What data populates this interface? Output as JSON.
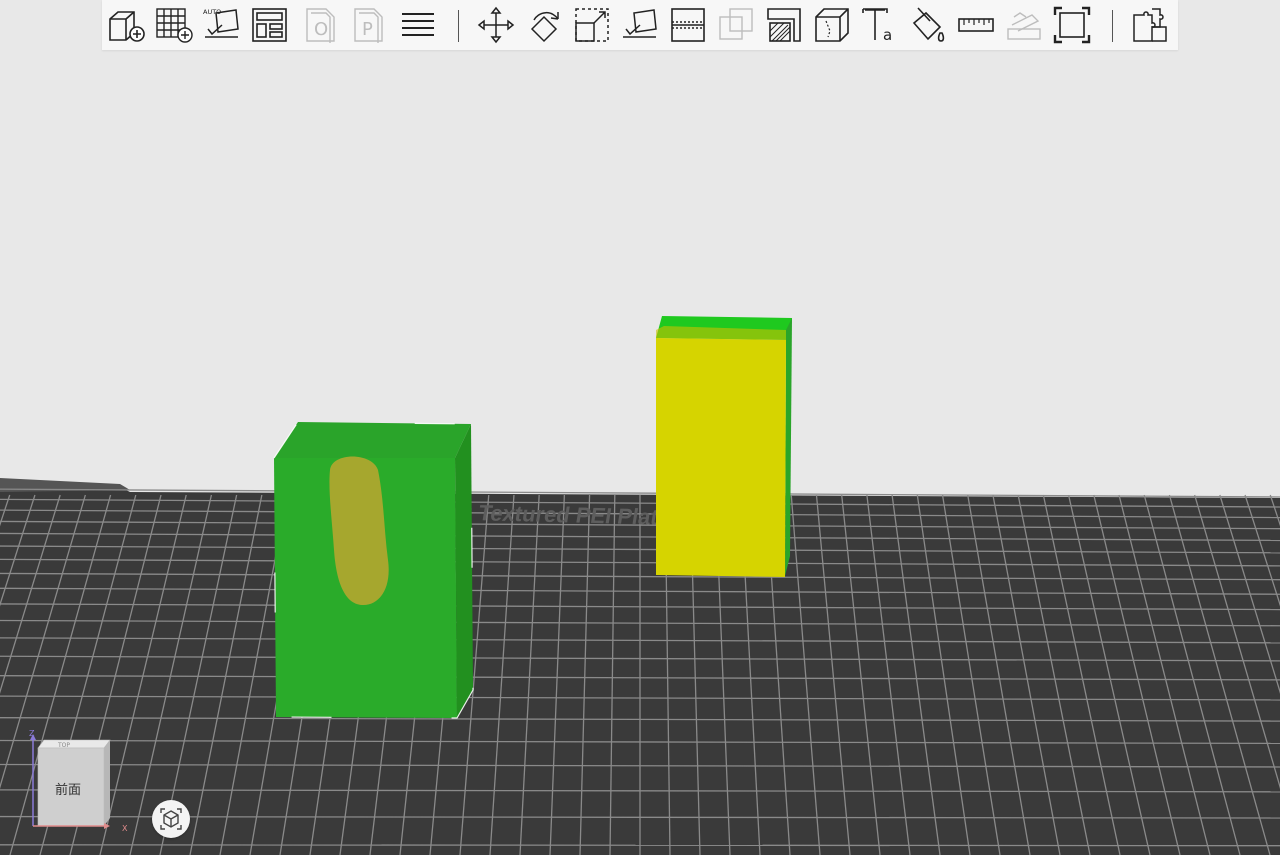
{
  "toolbar": {
    "items": [
      {
        "name": "add-object",
        "label": ""
      },
      {
        "name": "add-plate",
        "label": ""
      },
      {
        "name": "auto-orient",
        "label": "AUTO"
      },
      {
        "name": "arrange",
        "label": ""
      },
      {
        "name": "object-list",
        "label": "O"
      },
      {
        "name": "plate-list",
        "label": "P"
      },
      {
        "name": "layers",
        "label": ""
      },
      {
        "name": "move",
        "label": ""
      },
      {
        "name": "rotate",
        "label": ""
      },
      {
        "name": "scale",
        "label": ""
      },
      {
        "name": "lay-on-face",
        "label": ""
      },
      {
        "name": "cut",
        "label": ""
      },
      {
        "name": "boolean",
        "label": ""
      },
      {
        "name": "support-paint",
        "label": ""
      },
      {
        "name": "seam-paint",
        "label": ""
      },
      {
        "name": "text",
        "label": "Ta"
      },
      {
        "name": "color-paint",
        "label": ""
      },
      {
        "name": "measure",
        "label": ""
      },
      {
        "name": "assembly",
        "label": ""
      },
      {
        "name": "fit-view",
        "label": ""
      },
      {
        "name": "variable-layer",
        "label": ""
      }
    ]
  },
  "bed": {
    "label": "Bambu Textured PEI Plate"
  },
  "viewcube": {
    "face_label": "前面",
    "top_label": "TOP",
    "axis_x": "X",
    "axis_z": "Z"
  },
  "colors": {
    "background": "#e8e8e8",
    "bed": "#3a3a3a",
    "grid": "#8a8a8a",
    "green_object": "#2aab2a",
    "green_side": "#22901f",
    "yellow_object": "#d6d400",
    "paint_blob": "#a6a72e"
  }
}
